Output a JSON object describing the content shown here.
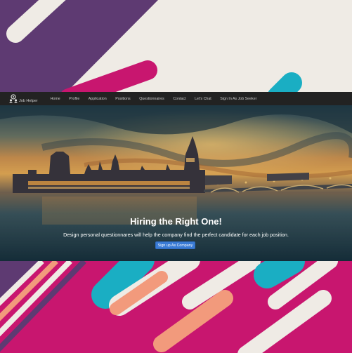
{
  "app": {
    "brand_name": "Job Helper",
    "logo_icon": "people-gear-icon"
  },
  "nav": {
    "items": [
      {
        "label": "Home"
      },
      {
        "label": "Profile"
      },
      {
        "label": "Application"
      },
      {
        "label": "Positions"
      },
      {
        "label": "Questionnaires"
      },
      {
        "label": "Contact"
      },
      {
        "label": "Let's Chat"
      },
      {
        "label": "Sign In As Job Seeker"
      }
    ]
  },
  "hero": {
    "title": "Hiring the Right One!",
    "subtitle": "Design personal questionnares will help the company find the perfect candidate for each job position.",
    "cta_label": "Sign up As Company",
    "cta_color": "#3a7bd5"
  },
  "colors": {
    "purple": "#5e3a72",
    "magenta": "#c8166f",
    "teal": "#1aaec3",
    "salmon": "#f29a7c",
    "cream": "#efebe5"
  }
}
